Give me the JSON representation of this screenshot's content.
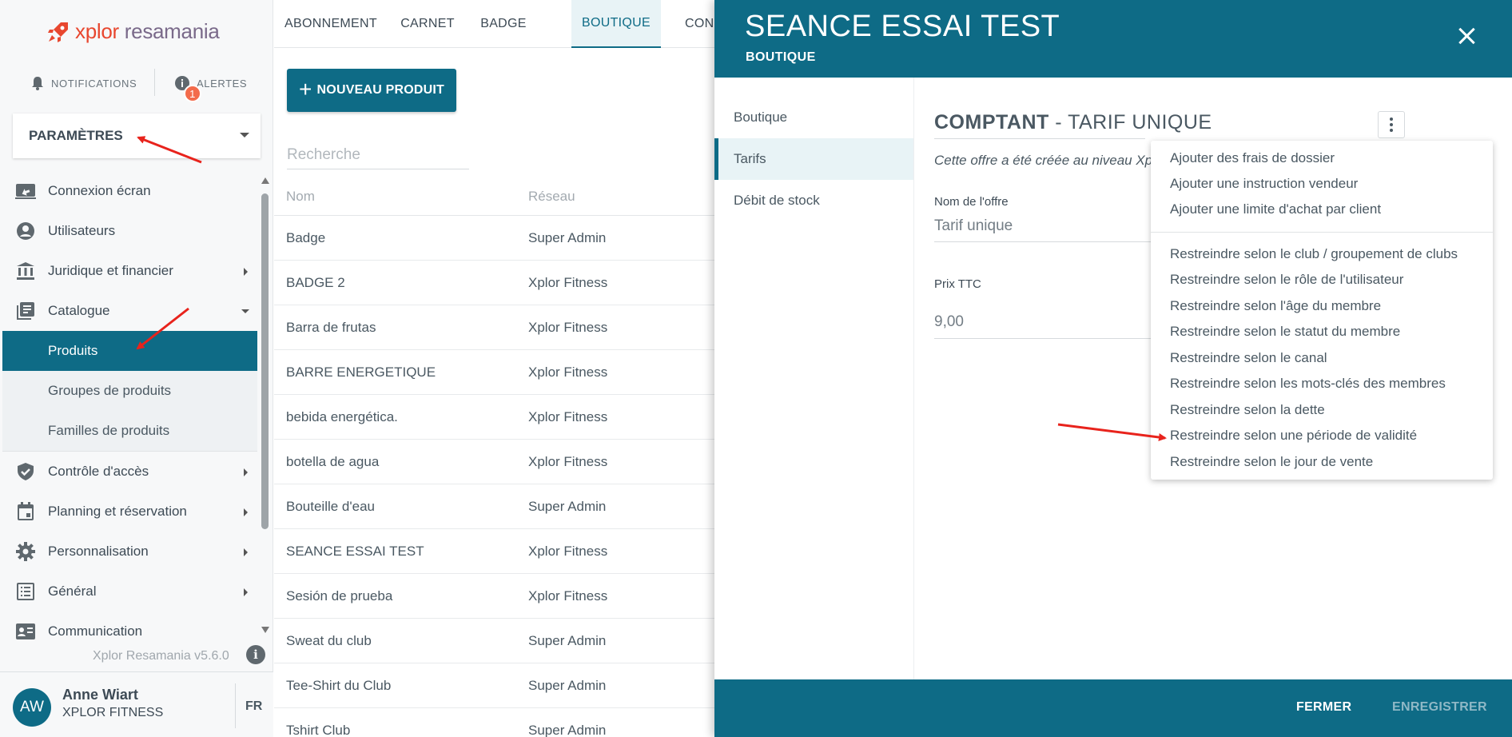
{
  "brand": {
    "logo_part1": "xplor",
    "logo_part2": "resamania",
    "accent": "#0e6b86",
    "logo_color": "#e8472f"
  },
  "topbar": {
    "notifications_label": "NOTIFICATIONS",
    "alerts_label": "ALERTES",
    "alerts_count": "1"
  },
  "settings_select": {
    "label": "PARAMÈTRES"
  },
  "sidebar": {
    "items": [
      {
        "label": "Connexion écran",
        "icon": "screen-share-icon"
      },
      {
        "label": "Utilisateurs",
        "icon": "user-circle-icon"
      },
      {
        "label": "Juridique et financier",
        "icon": "bank-icon"
      },
      {
        "label": "Catalogue",
        "icon": "catalog-icon"
      },
      {
        "label": "Contrôle d'accès",
        "icon": "shield-check-icon"
      },
      {
        "label": "Planning et réservation",
        "icon": "calendar-icon"
      },
      {
        "label": "Personnalisation",
        "icon": "gear-icon"
      },
      {
        "label": "Général",
        "icon": "list-icon"
      },
      {
        "label": "Communication",
        "icon": "contact-card-icon"
      }
    ],
    "catalogue_sub": [
      "Produits",
      "Groupes de produits",
      "Familles de produits"
    ],
    "version": "Xplor Resamania v5.6.0"
  },
  "user": {
    "initials": "AW",
    "name": "Anne Wiart",
    "org": "XPLOR FITNESS",
    "lang": "FR"
  },
  "main": {
    "tabs": [
      "ABONNEMENT",
      "CARNET",
      "BADGE",
      "BOUTIQUE",
      "CON"
    ],
    "new_button": "NOUVEAU PRODUIT",
    "search_placeholder": "Recherche",
    "columns": [
      "Nom",
      "Réseau"
    ],
    "rows": [
      [
        "Badge",
        "Super Admin"
      ],
      [
        "BADGE 2",
        "Xplor Fitness"
      ],
      [
        "Barra de frutas",
        "Xplor Fitness"
      ],
      [
        "BARRE ENERGETIQUE",
        "Xplor Fitness"
      ],
      [
        "bebida energética.",
        "Xplor Fitness"
      ],
      [
        "botella de agua",
        "Xplor Fitness"
      ],
      [
        "Bouteille d'eau",
        "Super Admin"
      ],
      [
        "SEANCE ESSAI TEST",
        "Xplor Fitness"
      ],
      [
        "Sesión de prueba",
        "Xplor Fitness"
      ],
      [
        "Sweat du club",
        "Super Admin"
      ],
      [
        "Tee-Shirt du Club",
        "Super Admin"
      ],
      [
        "Tshirt Club",
        "Super Admin"
      ]
    ]
  },
  "panel": {
    "title": "SEANCE ESSAI TEST",
    "subtitle": "BOUTIQUE",
    "nav": [
      "Boutique",
      "Tarifs",
      "Débit de stock"
    ],
    "offer_type": "COMPTANT",
    "offer_sep": " - ",
    "offer_name": "TARIF UNIQUE",
    "note": "Cette offre a été créée au niveau Xp",
    "fields": {
      "name_label": "Nom de l'offre",
      "name_value": "Tarif unique",
      "price_label": "Prix TTC",
      "price_value": "9,00"
    },
    "footer": {
      "close": "FERMER",
      "save": "ENREGISTRER"
    }
  },
  "dropdown": {
    "group1": [
      "Ajouter des frais de dossier",
      "Ajouter une instruction vendeur",
      "Ajouter une limite d'achat par client"
    ],
    "group2": [
      "Restreindre selon le club / groupement de clubs",
      "Restreindre selon le rôle de l'utilisateur",
      "Restreindre selon l'âge du membre",
      "Restreindre selon le statut du membre",
      "Restreindre selon le canal",
      "Restreindre selon les mots-clés des membres",
      "Restreindre selon la dette",
      "Restreindre selon une période de validité",
      "Restreindre selon le jour de vente"
    ]
  }
}
